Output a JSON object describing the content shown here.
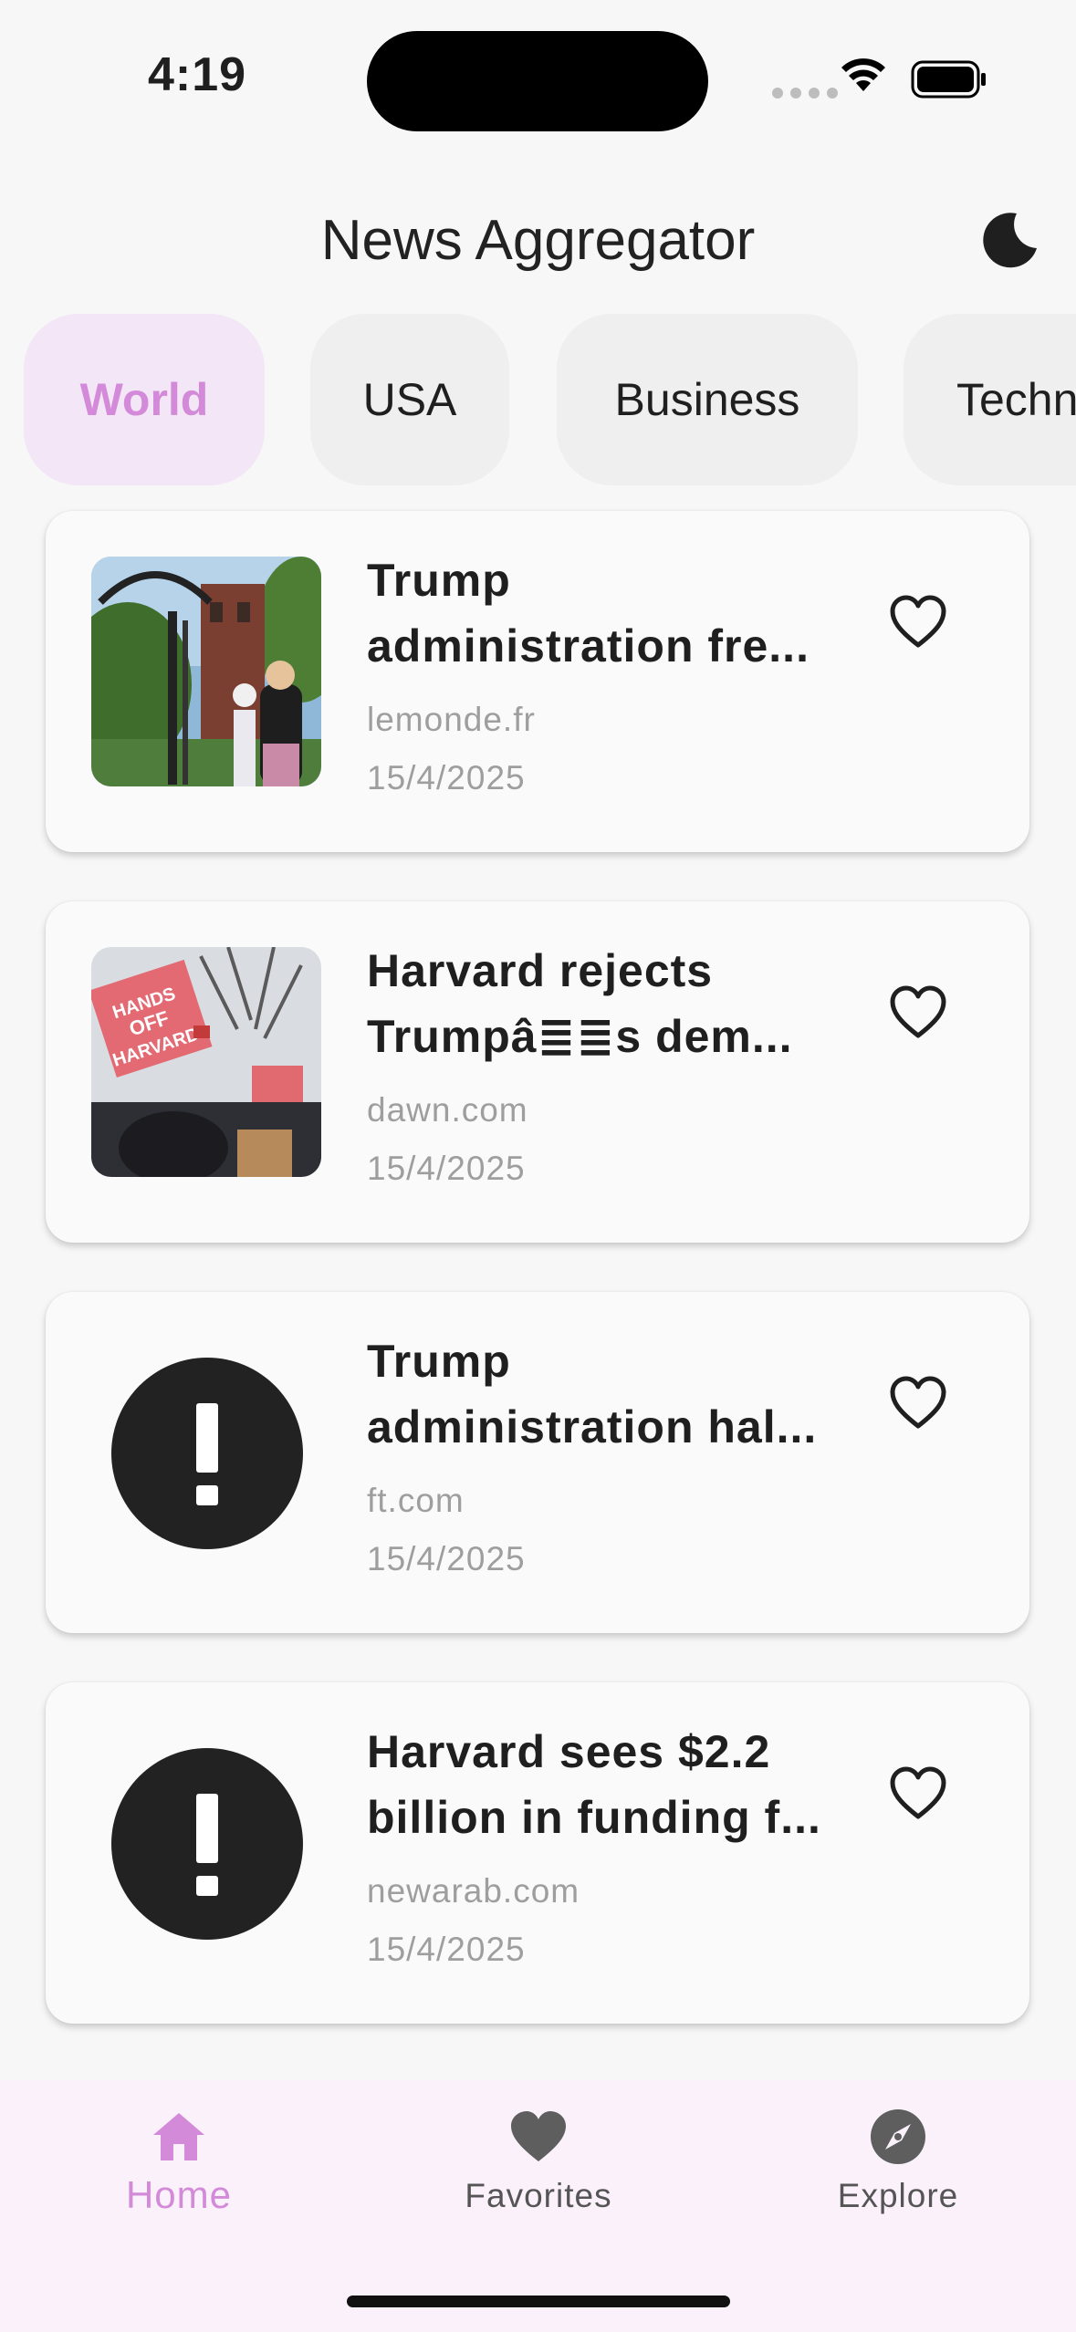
{
  "status": {
    "time": "4:19"
  },
  "header": {
    "title": "News Aggregator",
    "theme_icon": "moon-icon"
  },
  "categories": [
    {
      "label": "World",
      "active": true
    },
    {
      "label": "USA",
      "active": false
    },
    {
      "label": "Business",
      "active": false
    },
    {
      "label": "Techn",
      "active": false
    }
  ],
  "articles": [
    {
      "title_line1": "Trump",
      "title_line2": "administration fre...",
      "source": "lemonde.fr",
      "date": "15/4/2025",
      "thumbnail": "photo: university gate with students"
    },
    {
      "title_line1": "Harvard rejects",
      "title_line2": "Trumpâ≣≣s dem...",
      "source": "dawn.com",
      "date": "15/4/2025",
      "thumbnail": "photo: protest signs 'HANDS OFF HARVARD'"
    },
    {
      "title_line1": "Trump",
      "title_line2": "administration hal...",
      "source": "ft.com",
      "date": "15/4/2025",
      "thumbnail": "error-icon"
    },
    {
      "title_line1": "Harvard sees $2.2",
      "title_line2": "billion in funding f...",
      "source": "newarab.com",
      "date": "15/4/2025",
      "thumbnail": "error-icon"
    }
  ],
  "nav": [
    {
      "label": "Home",
      "icon": "home-icon",
      "active": true
    },
    {
      "label": "Favorites",
      "icon": "heart-icon",
      "active": false
    },
    {
      "label": "Explore",
      "icon": "compass-icon",
      "active": false
    }
  ],
  "colors": {
    "accent": "#d38ad8",
    "chip_active_bg": "#f3e6f6",
    "nav_bg": "#fbf1fb"
  }
}
